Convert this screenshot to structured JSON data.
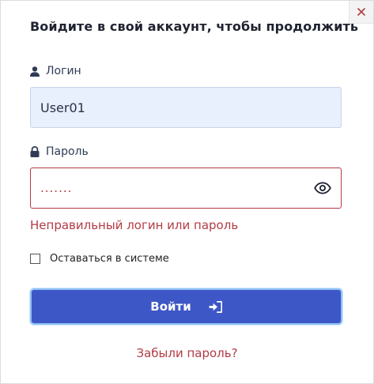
{
  "dialog": {
    "title": "Войдите в свой аккаунт, чтобы продолжить",
    "close_icon": "close-icon"
  },
  "login": {
    "label": "Логин",
    "icon": "user-icon",
    "value": "User01"
  },
  "password": {
    "label": "Пароль",
    "icon": "lock-icon",
    "masked_value": ".......",
    "toggle_icon": "eye-icon"
  },
  "error": {
    "text": "Неправильный логин или пароль"
  },
  "remember": {
    "label": "Оставаться в системе",
    "checked": false
  },
  "submit": {
    "label": "Войти",
    "icon": "sign-in-icon"
  },
  "forgot": {
    "label": "Забыли пароль?"
  },
  "colors": {
    "primary": "#3d57c7",
    "error": "#b23b45",
    "input_fill": "#e8effd",
    "focus_ring": "#8fc1f5"
  }
}
